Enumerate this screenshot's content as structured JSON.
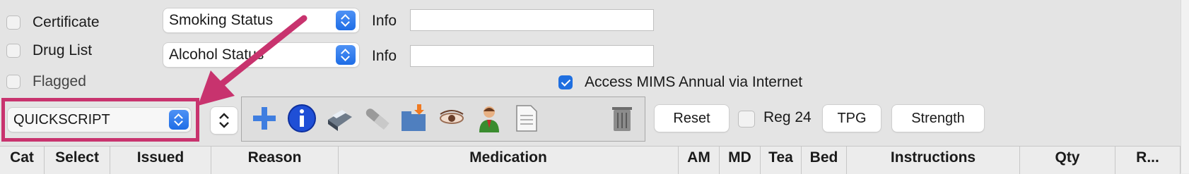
{
  "options": {
    "certificate_label": "Certificate",
    "drug_list_label": "Drug List",
    "flagged_label": "Flagged"
  },
  "status": {
    "smoking_select": "Smoking Status",
    "alcohol_select": "Alcohol Status",
    "info_label_1": "Info",
    "info_label_2": "Info",
    "info_value_1": "",
    "info_value_2": "",
    "access_mims_label": "Access MIMS Annual via Internet",
    "access_mims_checked": true
  },
  "script_select": {
    "value": "QUICKSCRIPT"
  },
  "toolbar": {
    "icons": [
      "add-icon",
      "info-icon",
      "print-icon",
      "pill-icon",
      "folder-import-icon",
      "eye-icon",
      "patient-icon",
      "document-icon",
      "trash-icon"
    ]
  },
  "actions": {
    "reset_label": "Reset",
    "reg24_label": "Reg 24",
    "reg24_checked": false,
    "tpg_label": "TPG",
    "strength_label": "Strength"
  },
  "table": {
    "columns": [
      "Cat",
      "Select",
      "Issued",
      "Reason",
      "Medication",
      "AM",
      "MD",
      "Tea",
      "Bed",
      "Instructions",
      "Qty",
      "R..."
    ]
  },
  "colors": {
    "accent_blue": "#1e6de6",
    "highlight_magenta": "#c8336e",
    "window_bg": "#e4e4e4"
  }
}
